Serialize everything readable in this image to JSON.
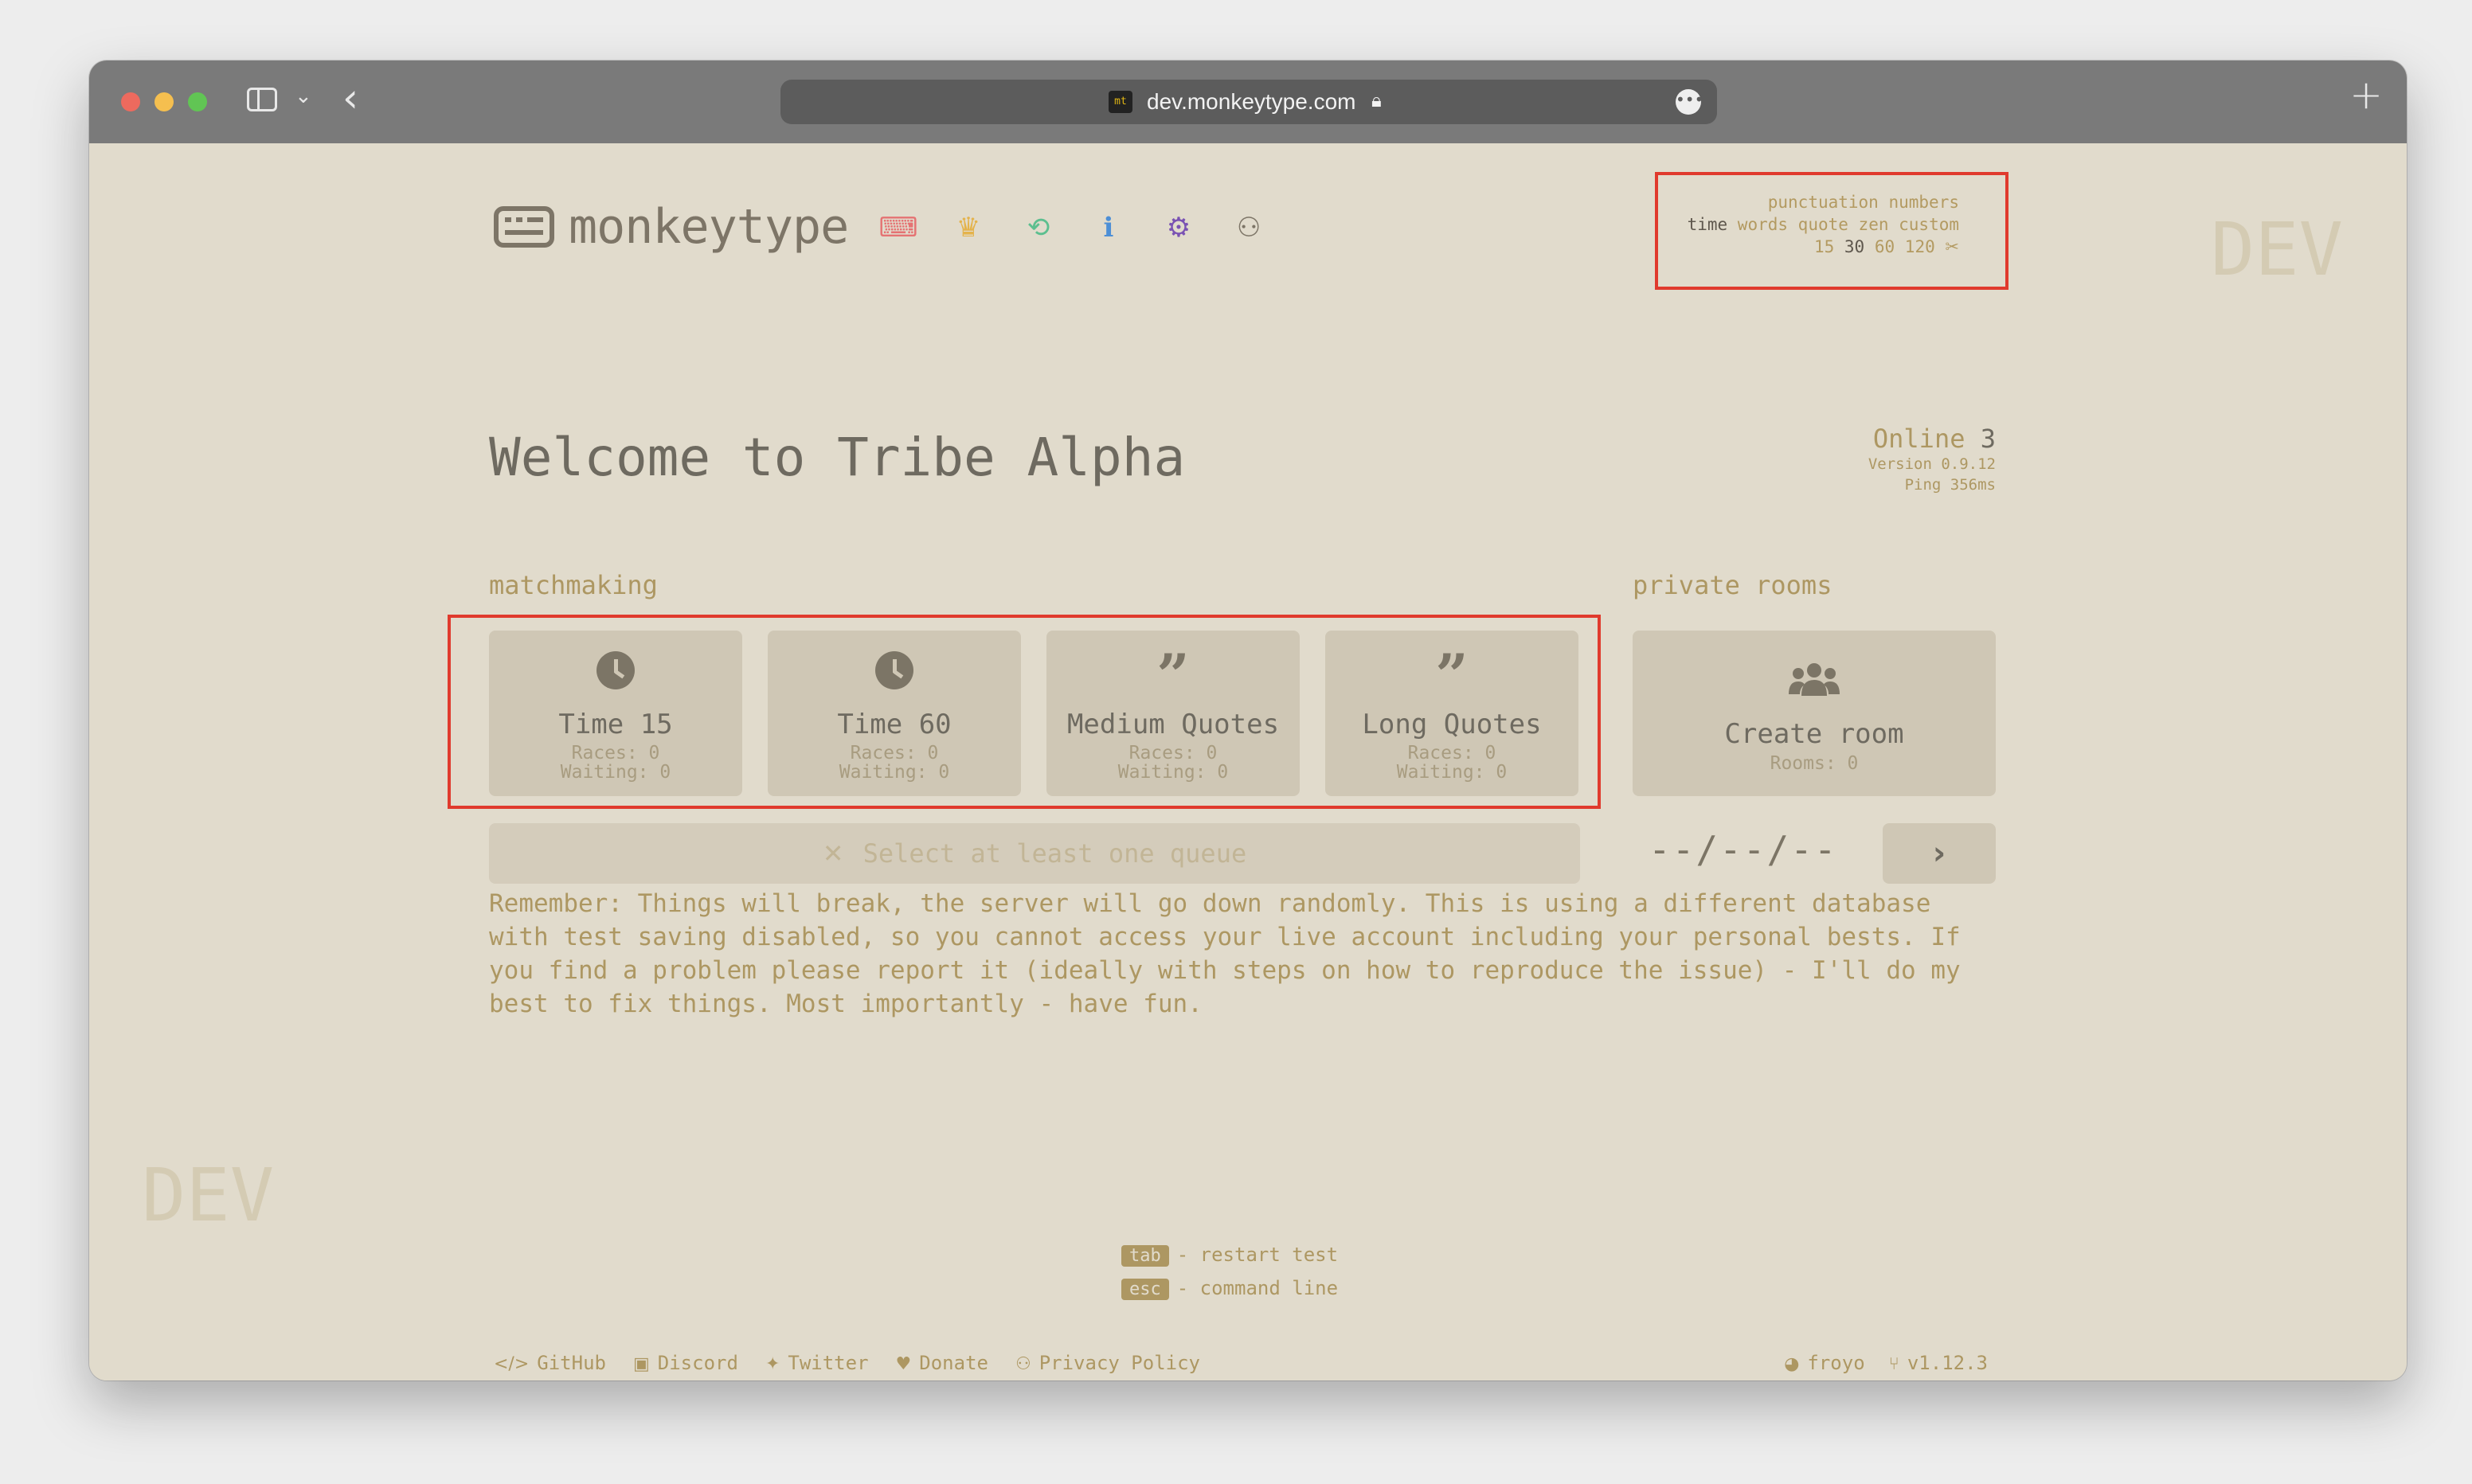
{
  "browser": {
    "url": "dev.monkeytype.com",
    "favicon_text": "mt"
  },
  "watermark": "DEV",
  "header": {
    "logo_text": "monkeytype",
    "nav_icons": [
      "keyboard-icon",
      "crown-icon",
      "tribe-icon",
      "info-icon",
      "gear-icon",
      "user-icon"
    ]
  },
  "config": {
    "row1": [
      "punctuation",
      "numbers"
    ],
    "row2": [
      "time",
      "words",
      "quote",
      "zen",
      "custom"
    ],
    "row3": [
      "15",
      "30",
      "60",
      "120"
    ]
  },
  "main": {
    "title": "Welcome to Tribe Alpha",
    "online_label": "Online",
    "online_count": "3",
    "version": "Version 0.9.12",
    "ping": "Ping 356ms",
    "matchmaking_label": "matchmaking",
    "private_rooms_label": "private rooms",
    "queues": [
      {
        "title": "Time 15",
        "races": "Races: 0",
        "waiting": "Waiting: 0",
        "icon": "clock-icon"
      },
      {
        "title": "Time 60",
        "races": "Races: 0",
        "waiting": "Waiting: 0",
        "icon": "clock-icon"
      },
      {
        "title": "Medium Quotes",
        "races": "Races: 0",
        "waiting": "Waiting: 0",
        "icon": "quote-icon"
      },
      {
        "title": "Long Quotes",
        "races": "Races: 0",
        "waiting": "Waiting: 0",
        "icon": "quote-icon"
      }
    ],
    "create_room": {
      "title": "Create room",
      "rooms": "Rooms: 0",
      "icon": "users-icon"
    },
    "select_queue": "Select at least one queue",
    "date_placeholder": "--/--/--",
    "notice": "Remember: Things will break, the server will go down randomly. This is using a different database with test saving disabled, so you cannot access your live account including your personal bests. If you find a problem please report it (ideally with steps on how to reproduce the issue) - I'll do my best to fix things. Most importantly - have fun."
  },
  "hints": [
    {
      "key": "tab",
      "text": "- restart test"
    },
    {
      "key": "esc",
      "text": "- command line"
    }
  ],
  "footer": {
    "links": [
      "GitHub",
      "Discord",
      "Twitter",
      "Donate",
      "Privacy Policy"
    ],
    "theme": "froyo",
    "version": "v1.12.3"
  },
  "colors": {
    "background": "#e1dbcc",
    "main": "#7d7567",
    "sub": "#ad9762",
    "highlight": "#e03a2d"
  }
}
